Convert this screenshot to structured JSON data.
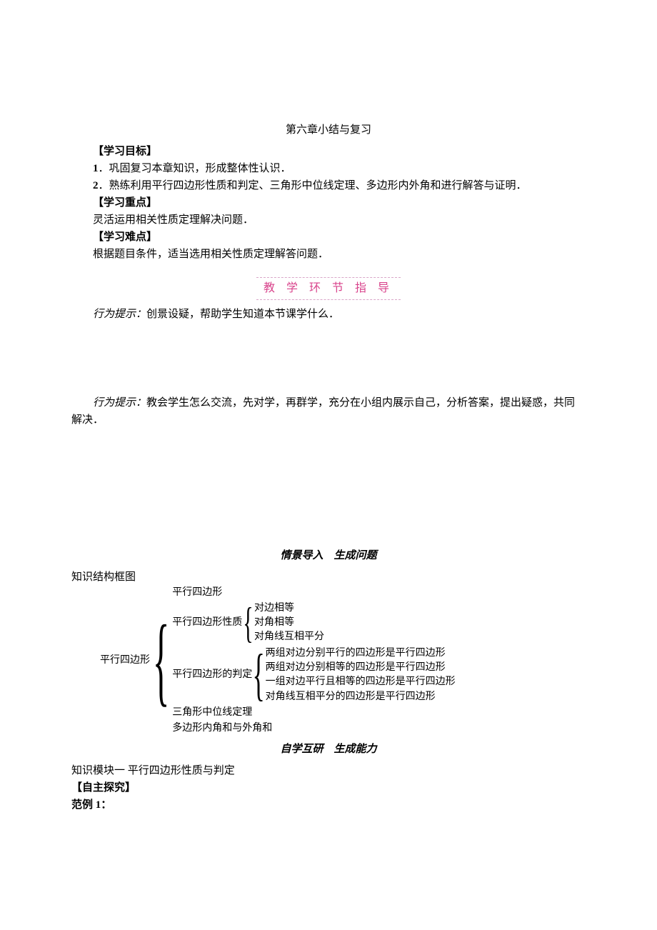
{
  "title": "第六章小结与复习",
  "labels": {
    "objective": "【学习目标】",
    "keypoint": "【学习重点】",
    "difficulty": "【学习难点】",
    "selfstudy": "【自主探究】"
  },
  "objectives": {
    "item1_num": "1",
    "item1_text": "．巩固复习本章知识，形成整体性认识．",
    "item2_num": "2",
    "item2_text": "．熟练利用平行四边形性质和判定、三角形中位线定理、多边形内外角和进行解答与证明．"
  },
  "keypoint_text": "灵活运用相关性质定理解决问题．",
  "difficulty_text": "根据题目条件，适当选用相关性质定理解答问题．",
  "banner": "教 学 环 节 指 导",
  "tip1_label": "行为提示：",
  "tip1_text": "创景设疑，帮助学生知道本节课学什么．",
  "tip2_label": "行为提示：",
  "tip2_text": "教会学生怎么交流，先对学，再群学，充分在小组内展示自己，分析答案，提出疑惑，共同解决．",
  "section_a": "情景导入　生成问题",
  "struct_title": "知识结构框图",
  "tree": {
    "root": "平行四边形",
    "c1": "平行四边形",
    "c2": "平行四边形性质",
    "c2_1": "对边相等",
    "c2_2": "对角相等",
    "c2_3": "对角线互相平分",
    "c3": "平行四边形的判定",
    "c3_1": "两组对边分别平行的四边形是平行四边形",
    "c3_2": "两组对边分别相等的四边形是平行四边形",
    "c3_3": "一组对边平行且相等的四边形是平行四边形",
    "c3_4": "对角线互相平分的四边形是平行四边形",
    "c4": "三角形中位线定理",
    "c5": "多边形内角和与外角和"
  },
  "section_b": "自学互研　生成能力",
  "module1": "知识模块一  平行四边形性质与判定",
  "example_label": "范例 1："
}
